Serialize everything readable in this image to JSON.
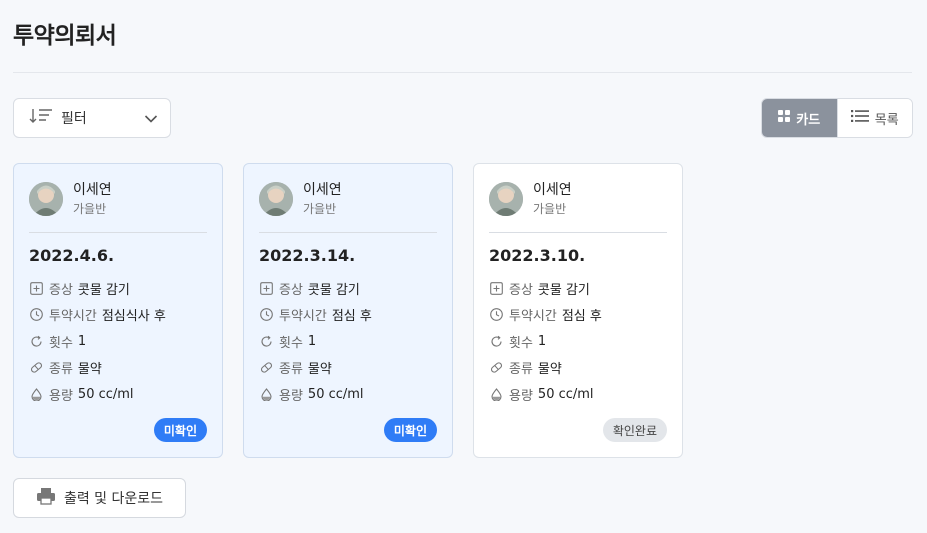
{
  "page": {
    "title": "투약의뢰서"
  },
  "filter": {
    "label": "필터"
  },
  "view_toggle": {
    "card_label": "카드",
    "list_label": "목록"
  },
  "colors": {
    "accent_blue": "#2f7cf6",
    "toggle_active": "#8b929d",
    "card_unconfirmed_bg": "#eef5ff"
  },
  "cards": [
    {
      "name": "이세연",
      "class": "가을반",
      "date": "2022.4.6.",
      "symptom_key": "증상",
      "symptom": "콧물 감기",
      "time_key": "투약시간",
      "time": "점심식사 후",
      "count_key": "횟수",
      "count": "1",
      "type_key": "종류",
      "type": "물약",
      "dose_key": "용량",
      "dose": "50 cc/ml",
      "status": "미확인"
    },
    {
      "name": "이세연",
      "class": "가을반",
      "date": "2022.3.14.",
      "symptom_key": "증상",
      "symptom": "콧물 감기",
      "time_key": "투약시간",
      "time": "점심 후",
      "count_key": "횟수",
      "count": "1",
      "type_key": "종류",
      "type": "물약",
      "dose_key": "용량",
      "dose": "50 cc/ml",
      "status": "미확인"
    },
    {
      "name": "이세연",
      "class": "가을반",
      "date": "2022.3.10.",
      "symptom_key": "증상",
      "symptom": "콧물 감기",
      "time_key": "투약시간",
      "time": "점심 후",
      "count_key": "횟수",
      "count": "1",
      "type_key": "종류",
      "type": "물약",
      "dose_key": "용량",
      "dose": "50 cc/ml",
      "status": "확인완료"
    }
  ],
  "print": {
    "label": "출력 및 다운로드"
  }
}
